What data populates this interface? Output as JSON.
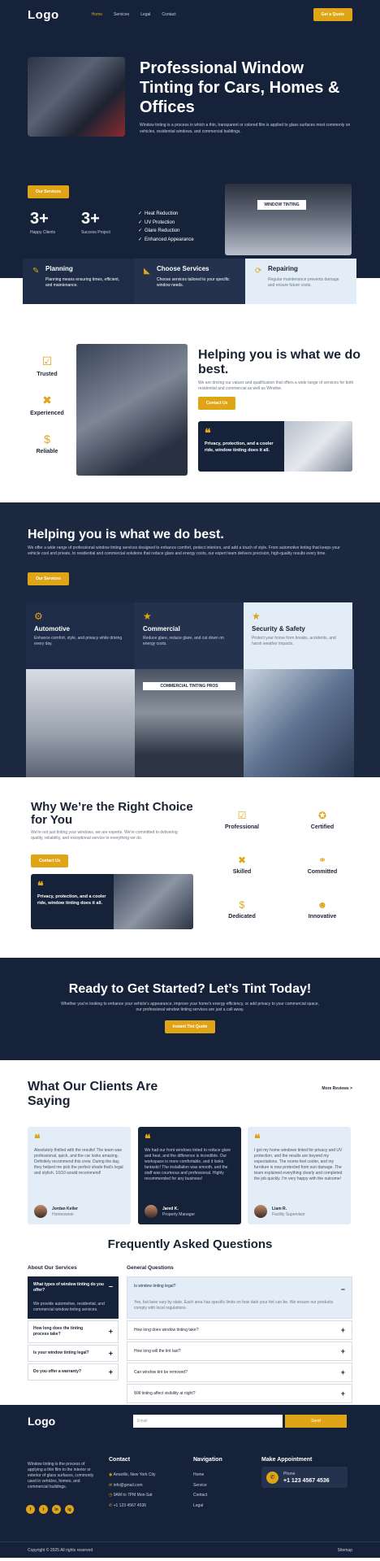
{
  "header": {
    "logo": "Logo",
    "nav": [
      "Home",
      "Services",
      "Legal",
      "Contact"
    ],
    "cta": "Get a Quote"
  },
  "hero": {
    "title": "Professional Window Tinting for Cars, Homes & Offices",
    "subtitle": "Window tinting is a process in which a thin, transparent or colored film is applied to glass surfaces most commonly on vehicles, residential windows, and commercial buildings.",
    "button": "Our Services",
    "stats": [
      {
        "value": "3+",
        "label": "Happy Clients"
      },
      {
        "value": "3+",
        "label": "Success Project"
      }
    ],
    "checks": [
      "Heat Reduction",
      "UV Protection",
      "Glare Reduction",
      "Enhanced Appearance"
    ],
    "storefront_sign": "WINDOW TINTING"
  },
  "services_bar": [
    {
      "icon": "edit-icon",
      "title": "Planning",
      "desc": "Planning means ensuring times, efficient, and maintenance."
    },
    {
      "icon": "megaphone-icon",
      "title": "Choose Services",
      "desc": "Choose services tailored to your specific window needs."
    },
    {
      "icon": "refresh-icon",
      "title": "Repairing",
      "desc": "Regular maintenance prevents damage and ensure future costs."
    }
  ],
  "helping1": {
    "badges": [
      "Trusted",
      "Experienced",
      "Reliable"
    ],
    "title": "Helping you is what we do best.",
    "subtitle": "We are driving our values and qualification that offers a wide range of services for both residential and commercial as well as Window.",
    "button": "Contact Us",
    "card_text": "Privacy, protection, and a cooler ride, window tinting does it all."
  },
  "helping2": {
    "title": "Helping you is what we do best.",
    "subtitle": "We offer a wide range of professional window tinting services designed to enhance comfort, protect interiors, and add a touch of style. From automotive tinting that keeps your vehicle cool and private, to residential and commercial solutions that reduce glare and energy costs, our expert team delivers precision, high-quality results every time.",
    "button": "Our Services",
    "features": [
      {
        "icon": "gear-icon",
        "title": "Automotive",
        "desc": "Enhance comfort, style, and privacy while driving every day."
      },
      {
        "icon": "star-icon",
        "title": "Commercial",
        "desc": "Reduce glare, reduce glare, and cut down on energy costs."
      },
      {
        "icon": "star-icon",
        "title": "Security & Safety",
        "desc": "Protect your home from breaks, accidents, and harsh weather impacts."
      }
    ],
    "photo_sign": "COMMERCIAL TINTING PROS"
  },
  "why": {
    "title": "Why We’re the Right Choice for You",
    "subtitle": "We're not just tinting your windows, we are experts. We're committed to delivering quality, reliability, and exceptional service to everything we do.",
    "button": "Contact Us",
    "card_text": "Privacy, protection, and a cooler ride, window tinting does it all.",
    "perks": [
      {
        "icon": "checkbox-icon",
        "label": "Professional"
      },
      {
        "icon": "award-icon",
        "label": "Certified"
      },
      {
        "icon": "tools-icon",
        "label": "Skilled"
      },
      {
        "icon": "handshake-icon",
        "label": "Committed"
      },
      {
        "icon": "dollar-icon",
        "label": "Dedicated"
      },
      {
        "icon": "user-idea-icon",
        "label": "Innovative"
      }
    ]
  },
  "cta": {
    "title": "Ready to Get Started? Let’s Tint Today!",
    "subtitle": "Whether you're looking to enhance your vehicle's appearance, improve your home's energy efficiency, or add privacy to your commercial space, our professional window tinting services are just a call away.",
    "button": "Instant Tint Quote"
  },
  "testimonials": {
    "title": "What Our Clients Are Saying",
    "more": "More Reviews >",
    "items": [
      {
        "text": "Absolutely thrilled with the results! The team was professional, quick, and the car looks amazing. Definitely recommend this crew. During the day, they helped me pick the perfect shade that's legal and stylish. 10/10 would recommend!",
        "name": "Jordan Keller",
        "role": "Homeowner"
      },
      {
        "text": "We had our front windows tinted to reduce glare and heat, and the difference is incredible. Our workspace is more comfortable, and it looks fantastic! The installation was smooth, and the staff was courteous and professional. Highly recommended for any business!",
        "name": "Jared K.",
        "role": "Property Manager"
      },
      {
        "text": "I got my home windows tinted for privacy and UV protection, and the results are beyond my expectations. The rooms feel cooler, and my furniture is now protected from sun damage. The team explained everything clearly and completed the job quickly. I'm very happy with the outcome!",
        "name": "Liam R.",
        "role": "Facility Supervisor"
      }
    ]
  },
  "faq": {
    "title": "Frequently Asked Questions",
    "about_heading": "About Our Services",
    "general_heading": "General Questions",
    "services": [
      {
        "q": "What types of window tinting do you offer?",
        "a": "We provide automotive, residential, and commercial window tinting services.",
        "open": true
      },
      {
        "q": "How long does the tinting process take?",
        "open": false
      },
      {
        "q": "Is your window tinting legal?",
        "open": false
      },
      {
        "q": "Do you offer a warranty?",
        "open": false
      }
    ],
    "general": [
      {
        "q": "Is window tinting legal?",
        "a": "Yes, but laws vary by state. Each area has specific limits on how dark your tint can be. We ensure our products comply with local regulations.",
        "open": true
      },
      {
        "q": "How long does window tinting take?",
        "open": false
      },
      {
        "q": "How long will the tint last?",
        "open": false
      },
      {
        "q": "Can window tint be removed?",
        "open": false
      },
      {
        "q": "Will tinting affect visibility at night?",
        "open": false
      }
    ]
  },
  "footer": {
    "logo": "Logo",
    "email_placeholder": "Email",
    "send": "Send",
    "about": "Window tinting is the process of applying a thin film to the interior or exterior of glass surfaces, commonly used in vehicles, homes, and commercial buildings.",
    "contact_heading": "Contact",
    "contact": [
      "Amarillo, New York City",
      "info@gmail.com",
      "9AM to 7PM Mon-Sat",
      "+1 123 4567 4536"
    ],
    "navigation_heading": "Navigation",
    "navigation": [
      "Home",
      "Service",
      "Contact",
      "Legal"
    ],
    "appointment_heading": "Make Appointment",
    "phone_label": "Phone",
    "phone": "+1 123 4567 4536",
    "social": [
      "f",
      "t",
      "in",
      "ig"
    ],
    "copyright": "Copyright © 2025 All rights reserved",
    "sitemap": "Sitemap"
  },
  "colors": {
    "navy": "#16223a",
    "gold": "#e0a517",
    "light_blue": "#e3edf8"
  }
}
